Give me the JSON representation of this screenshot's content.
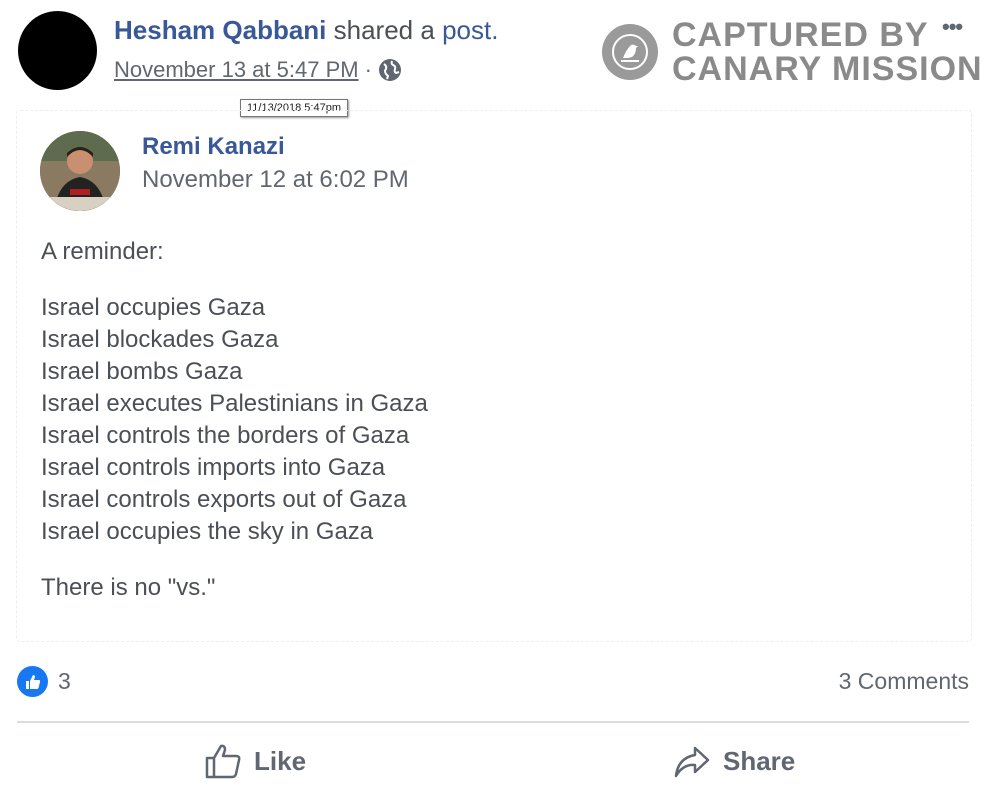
{
  "post": {
    "author": "Hesham Qabbani",
    "shared_text": "shared a",
    "shared_link": "post.",
    "timestamp": "November 13 at 5:47 PM",
    "separator": "·",
    "tooltip": "11/13/2018 5:47pm"
  },
  "watermark": {
    "line1": "CAPTURED BY",
    "line2": "CANARY MISSION"
  },
  "more_label": "•••",
  "shared_post": {
    "author": "Remi Kanazi",
    "timestamp": "November 12 at 6:02 PM",
    "intro": "A reminder:",
    "lines": [
      "Israel occupies Gaza",
      "Israel blockades Gaza",
      "Israel bombs Gaza",
      "Israel executes Palestinians in Gaza",
      "Israel controls the borders of Gaza",
      "Israel controls imports into Gaza",
      "Israel controls exports out of Gaza",
      "Israel occupies the sky in Gaza"
    ],
    "closing": "There is no \"vs.\""
  },
  "reactions": {
    "count": "3",
    "comments": "3 Comments"
  },
  "actions": {
    "like": "Like",
    "share": "Share"
  },
  "colors": {
    "link_blue": "#385898",
    "like_blue": "#1877f2",
    "text_gray": "#4b4f56"
  }
}
